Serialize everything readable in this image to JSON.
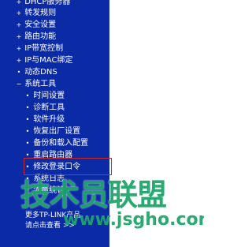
{
  "sidebar": {
    "bg_color": "#0b2aa6",
    "text_color": "#ffffff",
    "items": [
      {
        "label": "DHCP服务器",
        "marker": "+"
      },
      {
        "label": "转发规则",
        "marker": "+"
      },
      {
        "label": "安全设置",
        "marker": "+"
      },
      {
        "label": "路由功能",
        "marker": "+"
      },
      {
        "label": "IP带宽控制",
        "marker": "+"
      },
      {
        "label": "IP与MAC绑定",
        "marker": "+"
      },
      {
        "label": "动态DNS",
        "marker": "•"
      },
      {
        "label": "系统工具",
        "marker": "−"
      },
      {
        "label": "时间设置",
        "marker": "•"
      },
      {
        "label": "诊断工具",
        "marker": "•"
      },
      {
        "label": "软件升级",
        "marker": "•"
      },
      {
        "label": "恢复出厂设置",
        "marker": "•"
      },
      {
        "label": "备份和载入配置",
        "marker": "•"
      },
      {
        "label": "重启路由器",
        "marker": "•"
      },
      {
        "label": "修改登录口令",
        "marker": "•"
      },
      {
        "label": "系统日志",
        "marker": "•"
      },
      {
        "label": "流量统计",
        "marker": "•"
      },
      {
        "label": "更多TP-LINK产品，",
        "marker": ""
      },
      {
        "label": "请点击查看 >>",
        "marker": ""
      }
    ],
    "highlight_color": "#c62a2a"
  },
  "watermark": {
    "logo_text": "技术员联盟",
    "url_text": "www.jsgho.com",
    "color": "#1ea66a"
  }
}
